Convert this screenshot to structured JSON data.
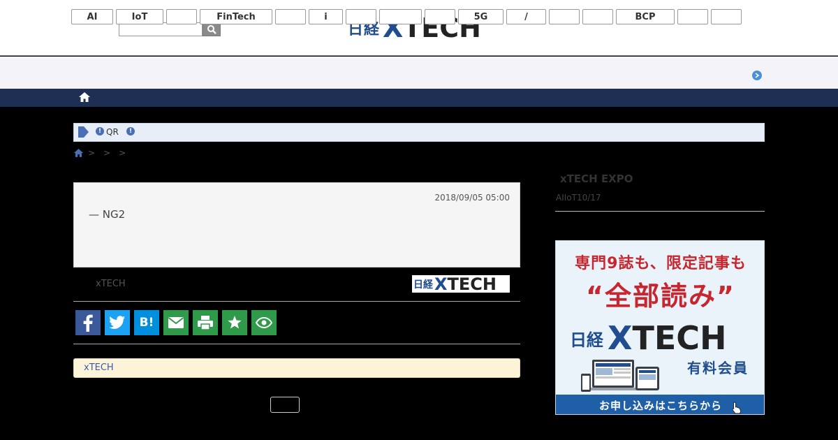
{
  "header": {
    "search": {
      "value": "",
      "placeholder": ""
    },
    "logo": {
      "nikkei": "日経",
      "xtech_x": "X",
      "xtech_rest": "TECH"
    }
  },
  "tags": [
    {
      "label": "AI"
    },
    {
      "label": "IoT"
    },
    {
      "label": ""
    },
    {
      "label": "FinTech"
    },
    {
      "label": ""
    },
    {
      "label": "i"
    },
    {
      "label": ""
    },
    {
      "label": ""
    },
    {
      "label": ""
    },
    {
      "label": "5G"
    },
    {
      "label": "/"
    },
    {
      "label": ""
    },
    {
      "label": ""
    },
    {
      "label": "BCP"
    },
    {
      "label": ""
    },
    {
      "label": ""
    }
  ],
  "notice": {
    "icon1": "!",
    "qr": "QR",
    "icon2": "!"
  },
  "breadcrumb": {
    "sep1": ">",
    "sep2": ">",
    "sep3": ">"
  },
  "article": {
    "date": "2018/09/05 05:00",
    "subtitle": "— NG2"
  },
  "source": {
    "text": "xTECH",
    "logo": {
      "nikkei": "日経",
      "xtech_x": "X",
      "xtech_rest": "TECH"
    }
  },
  "share_icons": [
    "facebook-icon",
    "twitter-icon",
    "hatena-icon",
    "mail-icon",
    "print-icon",
    "star-icon",
    "eye-icon"
  ],
  "colors": {
    "facebook": "#3b5998",
    "twitter": "#1da1f2",
    "hatena": "#008fde",
    "mail": "#2e9a4a",
    "print": "#2e9a4a",
    "star": "#2e9a4a",
    "eye": "#2e9a4a"
  },
  "member_note": {
    "text": "xTECH"
  },
  "sidebar": {
    "title": "xTECH EXPO",
    "subtitle": "AIIoT10/17"
  },
  "ad": {
    "line1": "専門9誌も、限定記事も",
    "line2": "“全部読み”",
    "logo": {
      "nikkei": "日経",
      "xtech_x": "X",
      "xtech_rest": "TECH"
    },
    "member": "有料会員",
    "cta": "お申し込みはこちらから"
  }
}
